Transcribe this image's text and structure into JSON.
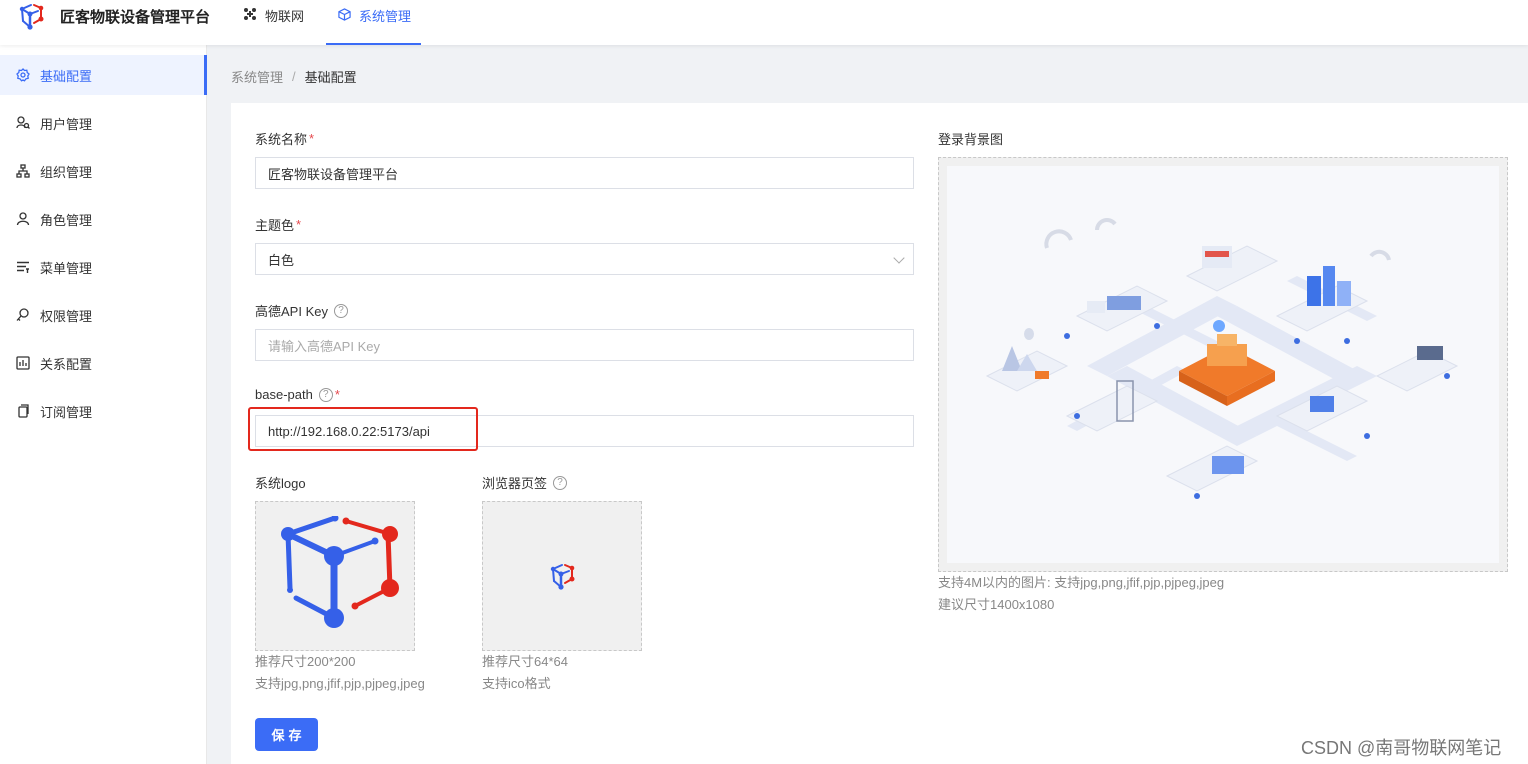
{
  "header": {
    "app_title": "匠客物联设备管理平台",
    "nav": [
      {
        "label": "物联网",
        "icon": "grid-icon",
        "active": false
      },
      {
        "label": "系统管理",
        "icon": "cube-icon",
        "active": true
      }
    ]
  },
  "sidebar": {
    "items": [
      {
        "label": "基础配置",
        "icon": "gear-icon",
        "active": true
      },
      {
        "label": "用户管理",
        "icon": "user-search-icon",
        "active": false
      },
      {
        "label": "组织管理",
        "icon": "org-chart-icon",
        "active": false
      },
      {
        "label": "角色管理",
        "icon": "person-icon",
        "active": false
      },
      {
        "label": "菜单管理",
        "icon": "menu-list-icon",
        "active": false
      },
      {
        "label": "权限管理",
        "icon": "key-search-icon",
        "active": false
      },
      {
        "label": "关系配置",
        "icon": "relation-chart-icon",
        "active": false
      },
      {
        "label": "订阅管理",
        "icon": "copy-icon",
        "active": false
      }
    ]
  },
  "breadcrumb": {
    "parent": "系统管理",
    "separator": "/",
    "current": "基础配置"
  },
  "form": {
    "system_name": {
      "label": "系统名称",
      "required": "*",
      "value": "匠客物联设备管理平台"
    },
    "theme_color": {
      "label": "主题色",
      "required": "*",
      "value": "白色"
    },
    "amap_key": {
      "label": "高德API Key",
      "help": "?",
      "placeholder": "请输入高德API Key"
    },
    "base_path": {
      "label": "base-path",
      "help": "?",
      "required": "*",
      "value": "http://192.168.0.22:5173/api"
    },
    "system_logo": {
      "label": "系统logo",
      "hint_size": "推荐尺寸200*200",
      "hint_format": "支持jpg,png,jfif,pjp,pjpeg,jpeg"
    },
    "favicon": {
      "label": "浏览器页签",
      "help": "?",
      "hint_size": "推荐尺寸64*64",
      "hint_format": "支持ico格式"
    },
    "login_bg": {
      "label": "登录背景图",
      "hint_format": "支持4M以内的图片: 支持jpg,png,jfif,pjp,pjpeg,jpeg",
      "hint_size": "建议尺寸1400x1080"
    },
    "save_label": "保存"
  },
  "watermark": "CSDN @南哥物联网笔记",
  "colors": {
    "primary": "#3b6cf6",
    "logo_blue": "#3560e8",
    "logo_red": "#e3281d",
    "highlight": "#e3281d",
    "iso_orange": "#f07a2a"
  }
}
